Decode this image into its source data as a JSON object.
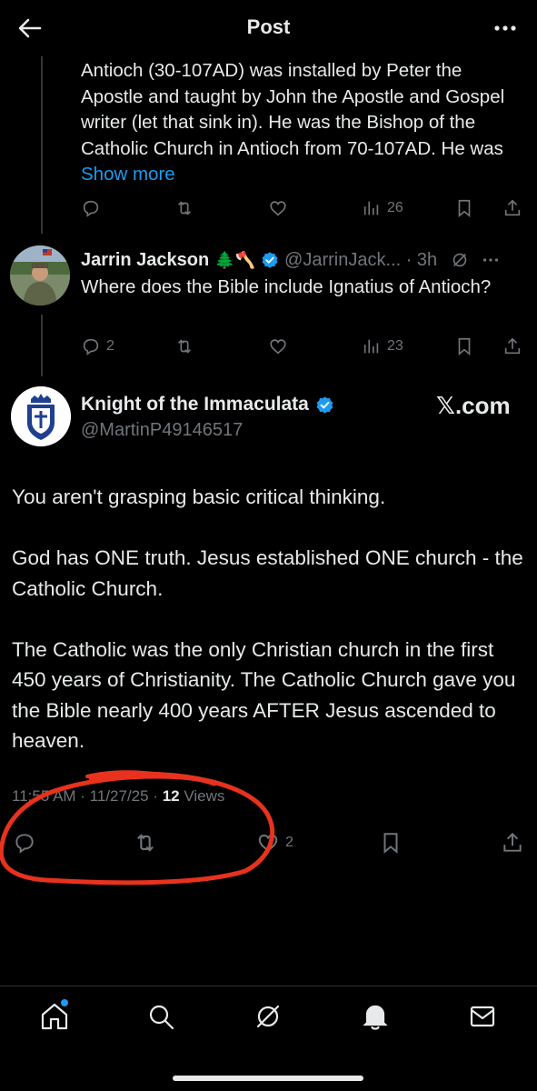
{
  "header": {
    "title": "Post"
  },
  "tweet1": {
    "text": "Antioch (30-107AD) was installed by Peter the Apostle and taught by John the Apostle and Gospel writer (let that sink in). He was the Bishop of the Catholic Church in Antioch from 70-107AD.  He was ",
    "show_more": "Show more",
    "views": "26"
  },
  "tweet2": {
    "name": "Jarrin Jackson",
    "emojis": "🌲🪓",
    "handle_time": "@JarrinJack... · 3h",
    "text": "Where does the Bible include Ignatius of Antioch?",
    "replies": "2",
    "views": "23"
  },
  "main_tweet": {
    "name": "Knight of the Immaculata",
    "handle": "@MartinP49146517",
    "watermark": "𝕏.com",
    "paragraphs": [
      "You aren't grasping basic critical thinking.",
      "God has ONE truth. Jesus established ONE church - the Catholic Church.",
      "The Catholic was the only Christian church in the first 450 years of Christianity. The Catholic Church gave you the Bible nearly 400 years AFTER Jesus ascended to heaven."
    ],
    "timestamp": "11:55 AM · 11/27/25 · ",
    "views_count": "12",
    "views_label": " Views",
    "likes": "2"
  },
  "colors": {
    "background": "#000000",
    "text": "#e7e9ea",
    "muted": "#71767b",
    "accent": "#1d9bf0",
    "annotation": "#e8321e"
  },
  "icons": [
    "back-arrow-icon",
    "more-icon",
    "reply-icon",
    "repost-icon",
    "like-icon",
    "views-icon",
    "bookmark-icon",
    "share-icon",
    "verified-icon",
    "grok-icon",
    "home-icon",
    "search-icon",
    "bell-icon",
    "mail-icon"
  ]
}
